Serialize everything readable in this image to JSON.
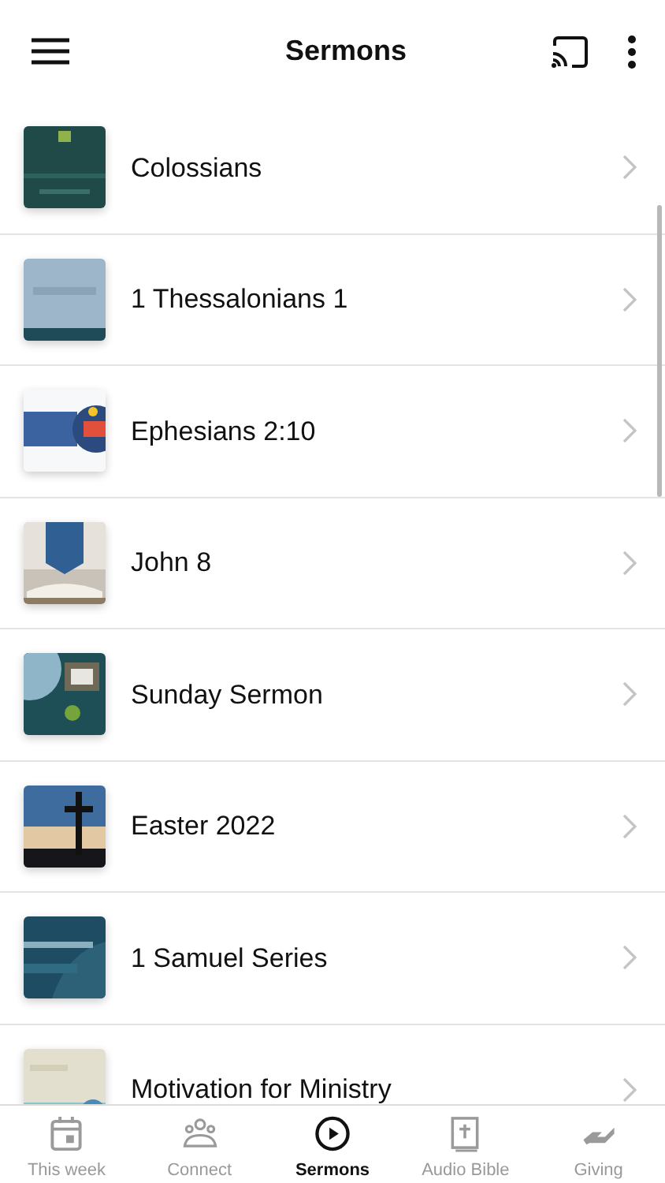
{
  "header": {
    "title": "Sermons"
  },
  "sermons": [
    {
      "title": "Colossians"
    },
    {
      "title": "1 Thessalonians 1"
    },
    {
      "title": "Ephesians 2:10"
    },
    {
      "title": "John 8"
    },
    {
      "title": "Sunday Sermon"
    },
    {
      "title": "Easter 2022"
    },
    {
      "title": "1 Samuel Series"
    },
    {
      "title": "Motivation for Ministry"
    }
  ],
  "tab_bar": [
    {
      "label": "This week",
      "selected": false
    },
    {
      "label": "Connect",
      "selected": false
    },
    {
      "label": "Sermons",
      "selected": true
    },
    {
      "label": "Audio Bible",
      "selected": false
    },
    {
      "label": "Giving",
      "selected": false
    }
  ]
}
